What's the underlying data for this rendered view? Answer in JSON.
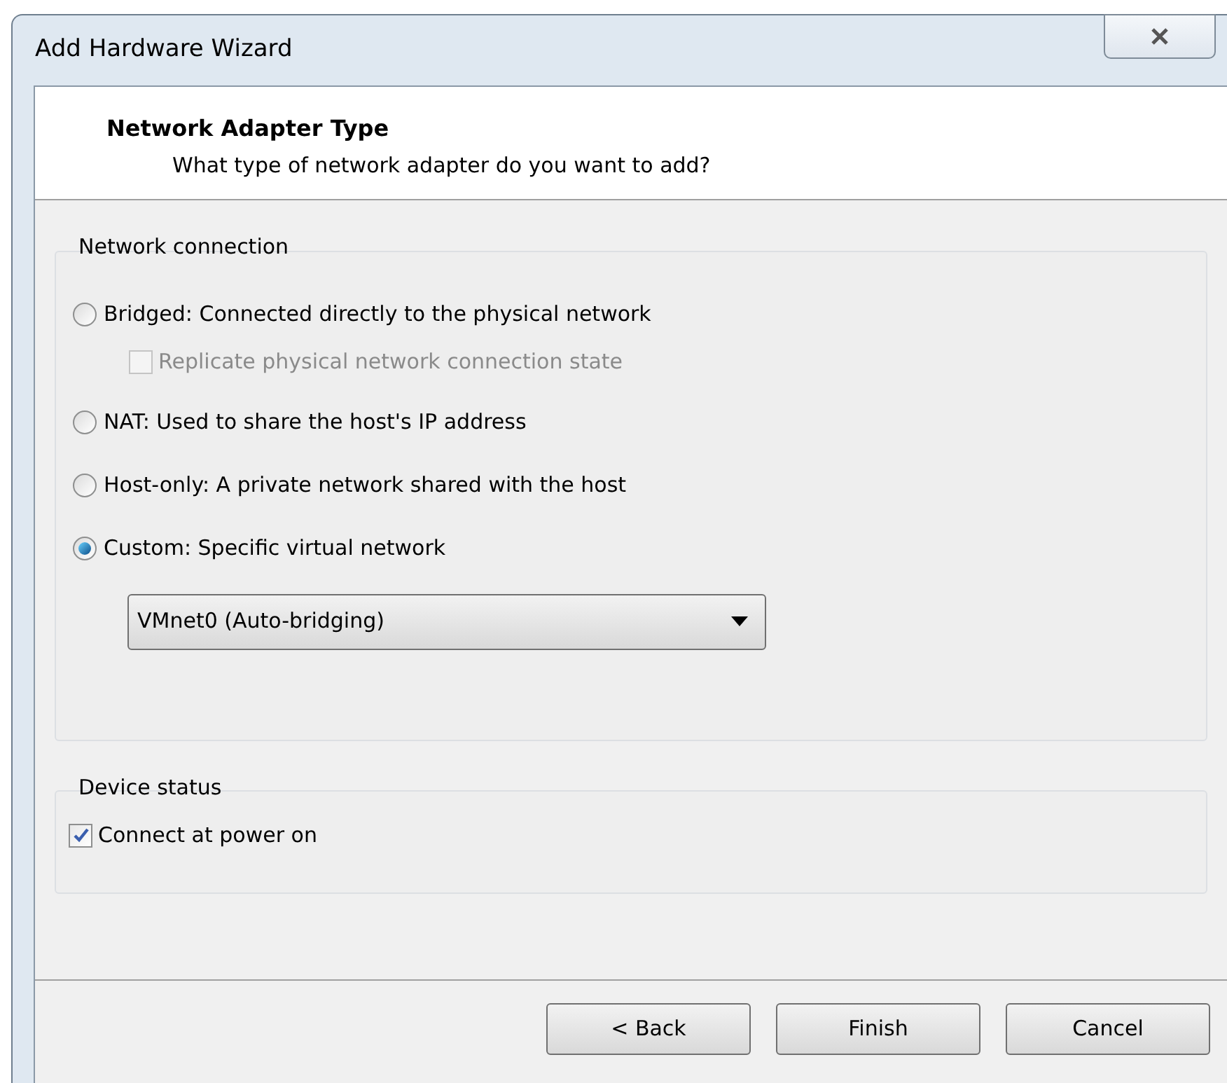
{
  "window": {
    "title": "Add Hardware Wizard"
  },
  "header": {
    "title": "Network Adapter Type",
    "subtitle": "What type of network adapter do you want to add?"
  },
  "network_connection": {
    "label": "Network connection",
    "options": [
      {
        "kind": "radio",
        "label": "Bridged: Connected directly to the physical network",
        "selected": false
      },
      {
        "kind": "checkbox",
        "label": "Replicate physical network connection state",
        "checked": false,
        "disabled": true
      },
      {
        "kind": "radio",
        "label": "NAT: Used to share the host's IP address",
        "selected": false
      },
      {
        "kind": "radio",
        "label": "Host-only: A private network shared with the host",
        "selected": false
      },
      {
        "kind": "radio",
        "label": "Custom: Specific virtual network",
        "selected": true
      },
      {
        "kind": "dropdown",
        "value": "VMnet0 (Auto-bridging)"
      }
    ]
  },
  "device_status": {
    "label": "Device status",
    "checkbox": {
      "label": "Connect at power on",
      "checked": true
    }
  },
  "buttons": [
    "< Back",
    "Finish",
    "Cancel"
  ]
}
